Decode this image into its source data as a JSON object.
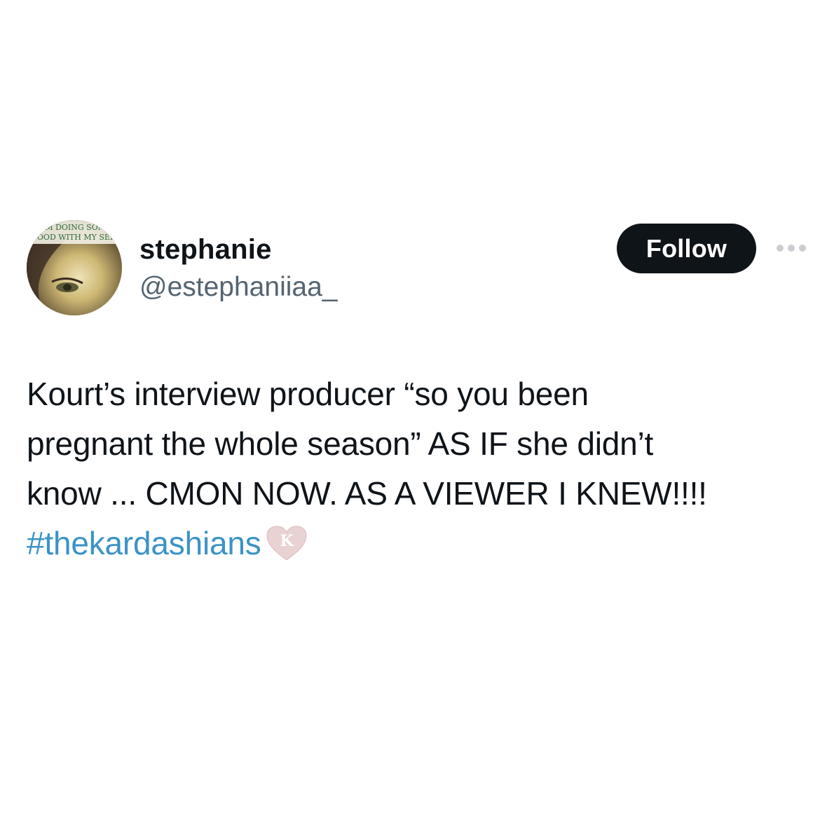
{
  "user": {
    "display_name": "stephanie",
    "handle": "@estephaniiaa_",
    "avatar_text_line1": "I'M DOING SOME",
    "avatar_text_line2": "GOOD WITH MY SELF"
  },
  "actions": {
    "follow_label": "Follow",
    "more_icon": "more-horizontal-icon"
  },
  "tweet": {
    "line1": "Kourt’s interview producer “so you been",
    "line2": "pregnant the whole season” AS IF she didn’t",
    "line3": "know ... CMON NOW. AS A VIEWER I KNEW!!!!",
    "hashtag": "#thekardashians",
    "hashtag_emoji": "kardashians-heart-icon",
    "hashtag_emoji_letter": "K"
  },
  "colors": {
    "background": "#ffffff",
    "text": "#0f1419",
    "secondary": "#536471",
    "link": "#3b93c7",
    "button_bg": "#0f1419",
    "button_text": "#ffffff",
    "heart": "#e9d2d2"
  }
}
